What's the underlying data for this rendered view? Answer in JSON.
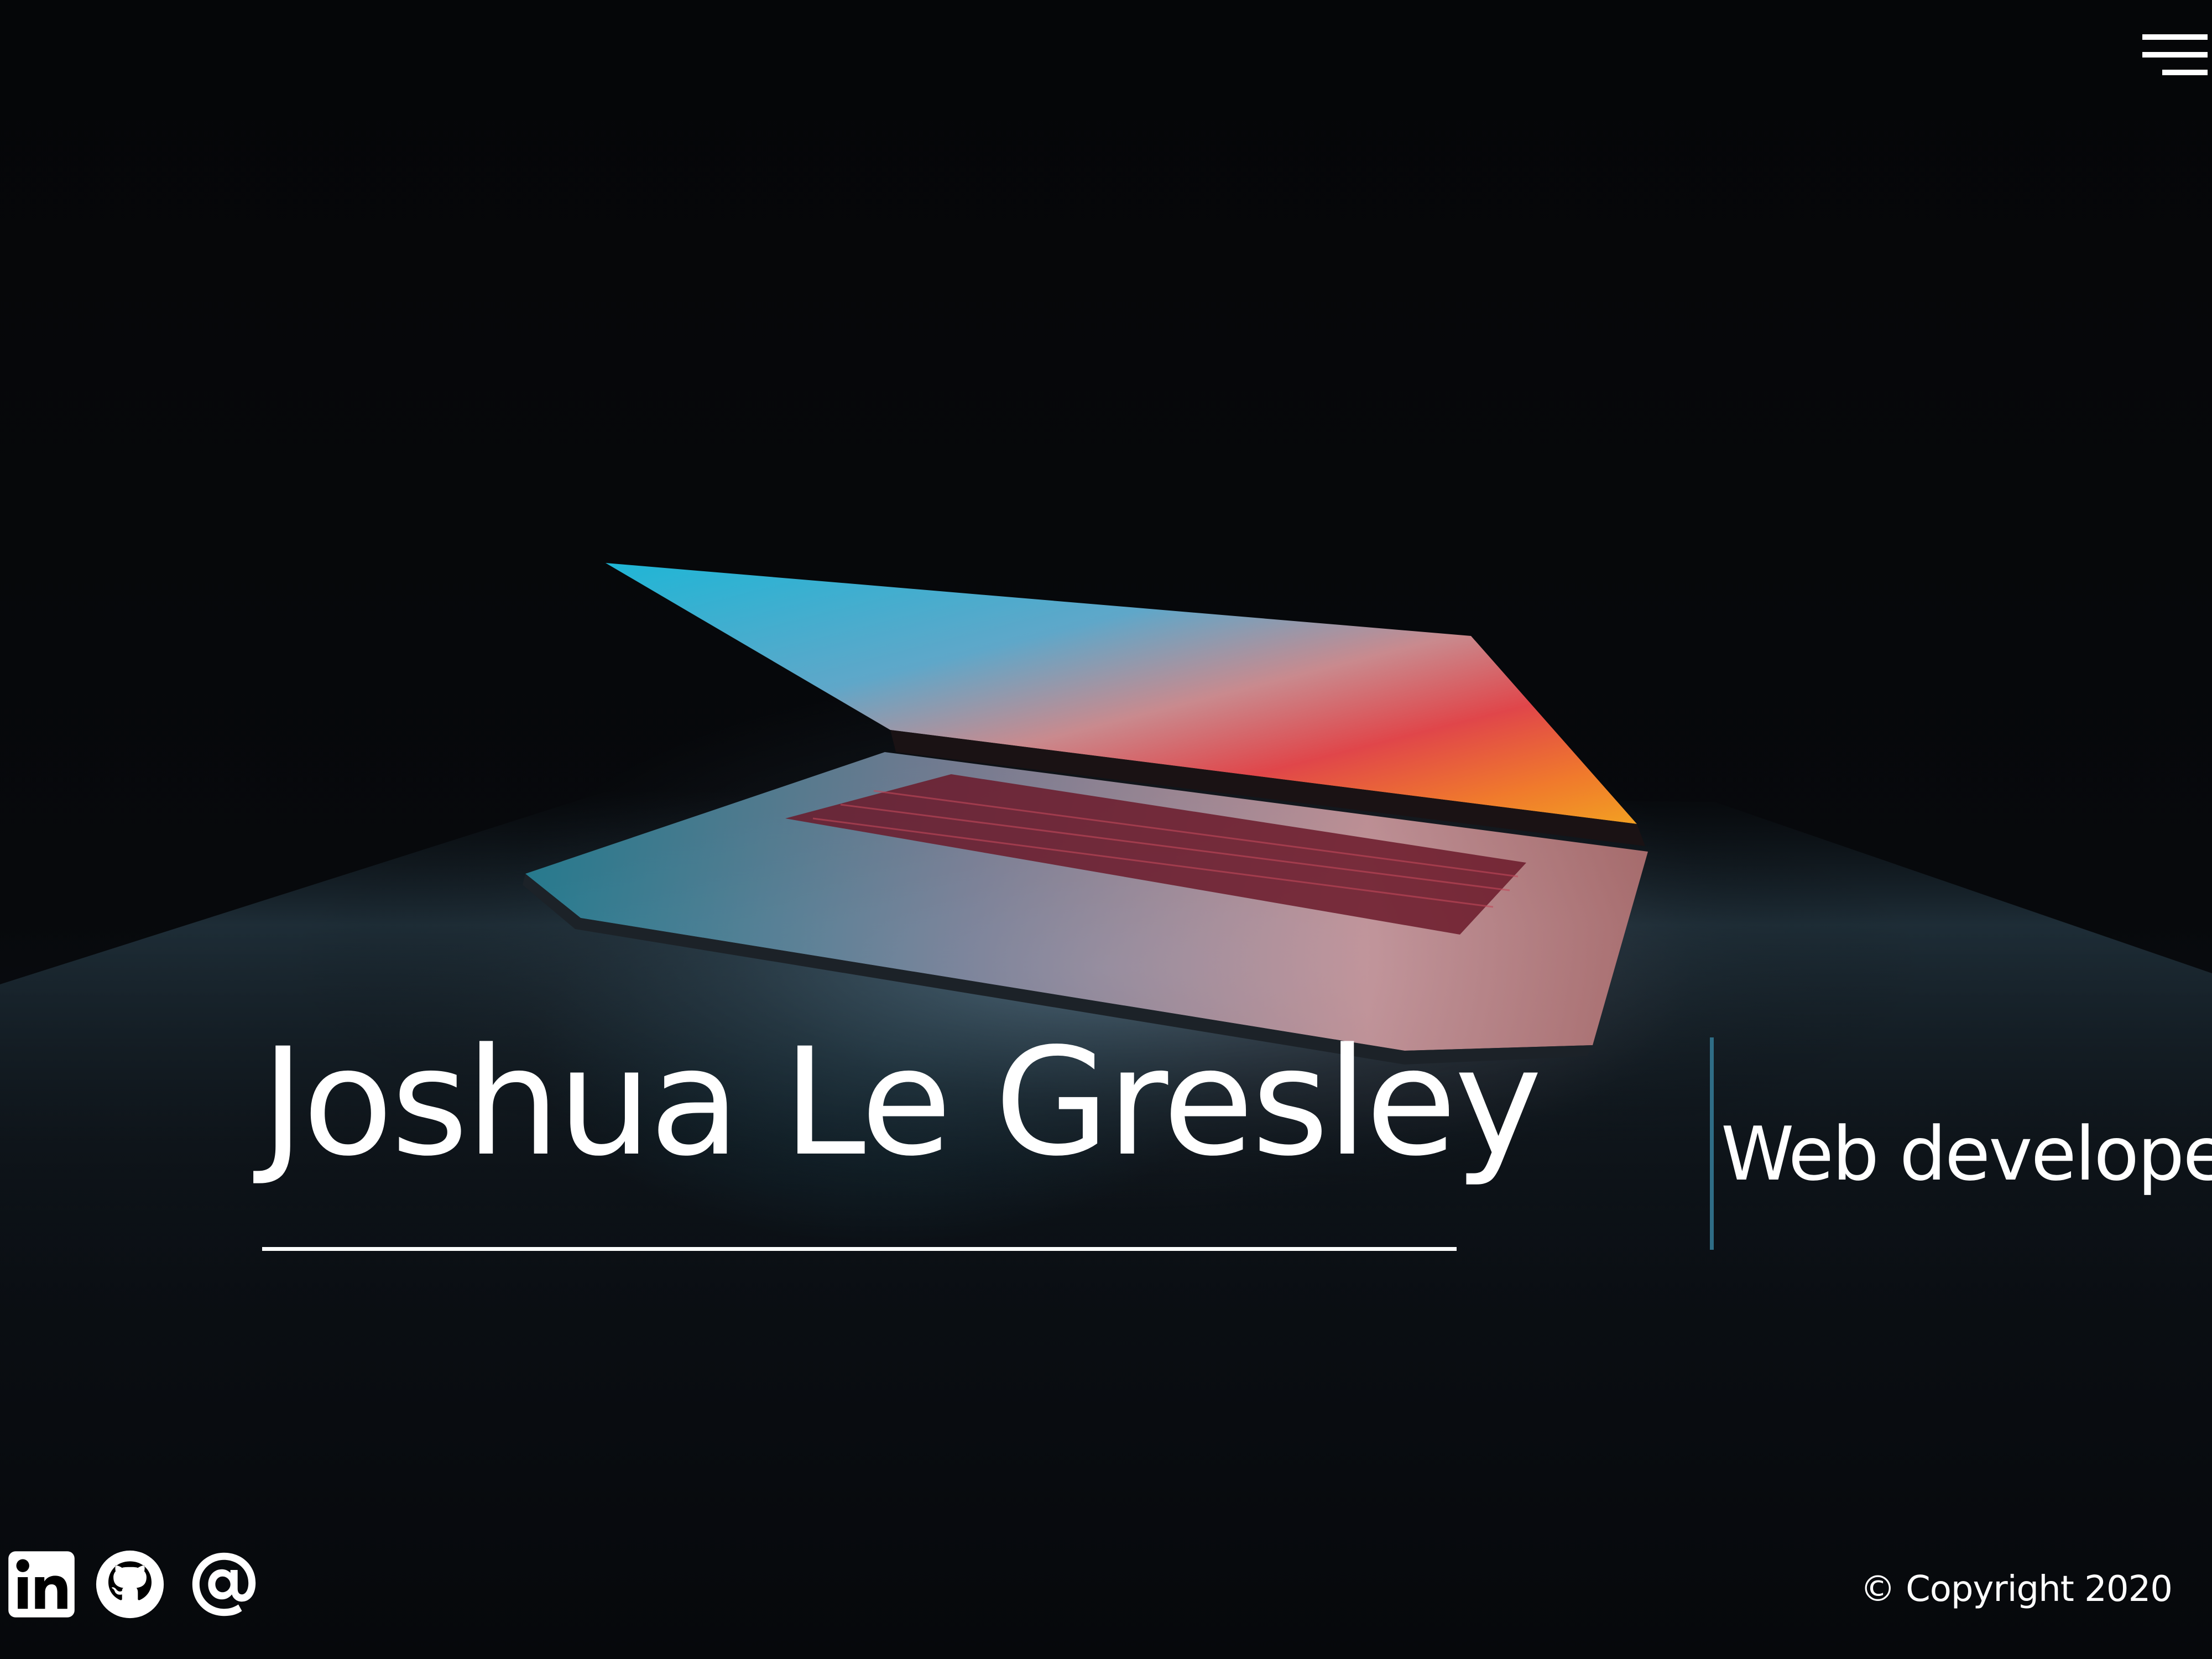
{
  "header": {
    "menu_icon": "hamburger-menu-icon"
  },
  "hero": {
    "name": "Joshua Le Gresley",
    "role": "Web developer"
  },
  "socials": [
    {
      "icon": "linkedin-icon"
    },
    {
      "icon": "github-icon"
    },
    {
      "icon": "email-at-icon"
    }
  ],
  "footer": {
    "copyright": "© Copyright 2020"
  },
  "colors": {
    "text": "#ffffff",
    "accent_cursor": "#2f6d86",
    "background": "#050608"
  }
}
